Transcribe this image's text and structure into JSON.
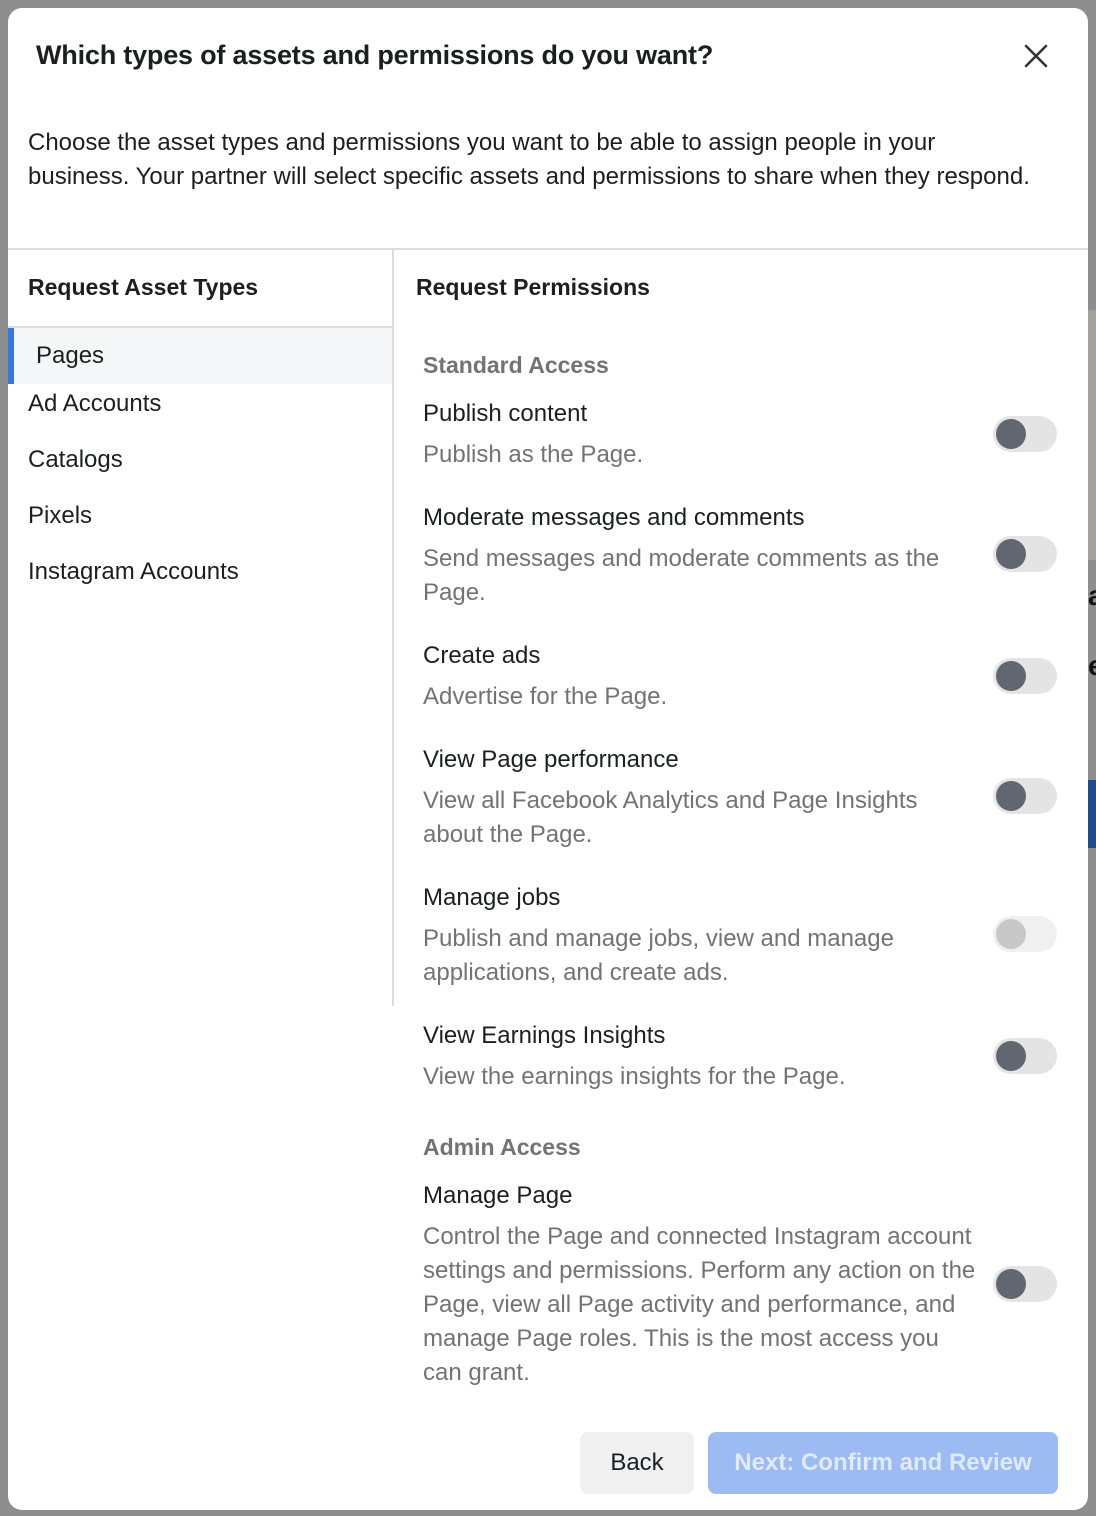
{
  "dialog": {
    "title": "Which types of assets and permissions do you want?",
    "close_icon": "close-icon",
    "intro": "Choose the asset types and permissions you want to be able to assign people in your business. Your partner will select specific assets and permissions to share when they respond."
  },
  "asset_types": {
    "heading": "Request Asset Types",
    "items": [
      {
        "label": "Pages",
        "selected": true
      },
      {
        "label": "Ad Accounts",
        "selected": false
      },
      {
        "label": "Catalogs",
        "selected": false
      },
      {
        "label": "Pixels",
        "selected": false
      },
      {
        "label": "Instagram Accounts",
        "selected": false
      }
    ]
  },
  "permissions": {
    "heading": "Request Permissions",
    "sections": [
      {
        "label": "Standard Access",
        "items": [
          {
            "title": "Publish content",
            "description": "Publish as the Page.",
            "enabled": false,
            "disabled": false
          },
          {
            "title": "Moderate messages and comments",
            "description": "Send messages and moderate comments as the Page.",
            "enabled": false,
            "disabled": false
          },
          {
            "title": "Create ads",
            "description": "Advertise for the Page.",
            "enabled": false,
            "disabled": false
          },
          {
            "title": "View Page performance",
            "description": "View all Facebook Analytics and Page Insights about the Page.",
            "enabled": false,
            "disabled": false
          },
          {
            "title": "Manage jobs",
            "description": "Publish and manage jobs, view and manage applications, and create ads.",
            "enabled": false,
            "disabled": true
          },
          {
            "title": "View Earnings Insights",
            "description": "View the earnings insights for the Page.",
            "enabled": false,
            "disabled": false
          }
        ]
      },
      {
        "label": "Admin Access",
        "items": [
          {
            "title": "Manage Page",
            "description": "Control the Page and connected Instagram account settings and permissions. Perform any action on the Page, view all Page activity and performance, and manage Page roles. This is the most access you can grant.",
            "enabled": false,
            "disabled": false
          }
        ]
      }
    ]
  },
  "footer": {
    "back_label": "Back",
    "next_label": "Next: Confirm and Review",
    "next_enabled": false
  },
  "colors": {
    "accent": "#3578e5",
    "next_button_disabled": "#9cbbf2",
    "toggle_knob": "#606770"
  }
}
